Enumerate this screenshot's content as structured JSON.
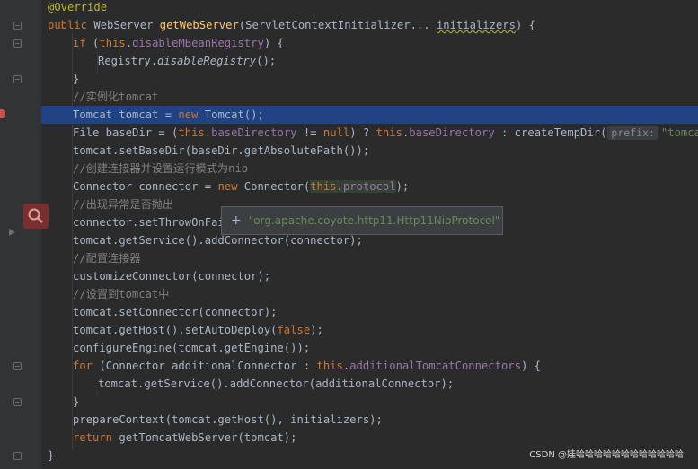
{
  "lines": [
    {
      "indent": 0,
      "tokens": [
        {
          "c": "ann",
          "t": "@Override"
        }
      ]
    },
    {
      "indent": 0,
      "tokens": [
        {
          "c": "kw",
          "t": "public "
        },
        {
          "c": "",
          "t": "WebServer "
        },
        {
          "c": "fn",
          "t": "getWebServer"
        },
        {
          "c": "",
          "t": "(ServletContextInitializer... "
        },
        {
          "c": "underline",
          "t": "initializers"
        },
        {
          "c": "",
          "t": ") {"
        }
      ]
    },
    {
      "indent": 1,
      "tokens": [
        {
          "c": "kw",
          "t": "if "
        },
        {
          "c": "",
          "t": "("
        },
        {
          "c": "kw",
          "t": "this"
        },
        {
          "c": "",
          "t": "."
        },
        {
          "c": "fld",
          "t": "disableMBeanRegistry"
        },
        {
          "c": "",
          "t": ") {"
        }
      ]
    },
    {
      "indent": 2,
      "tokens": [
        {
          "c": "",
          "t": "Registry."
        },
        {
          "c": "ital",
          "t": "disableRegistry"
        },
        {
          "c": "",
          "t": "();"
        }
      ]
    },
    {
      "indent": 1,
      "tokens": [
        {
          "c": "",
          "t": "}"
        }
      ]
    },
    {
      "indent": 1,
      "tokens": [
        {
          "c": "cmt",
          "t": "//实例化tomcat"
        }
      ]
    },
    {
      "indent": 1,
      "tokens": [
        {
          "c": "",
          "t": "Tomcat tomcat = "
        },
        {
          "c": "kw",
          "t": "new "
        },
        {
          "c": "",
          "t": "Tomcat();"
        }
      ]
    },
    {
      "indent": 1,
      "tokens": [
        {
          "c": "",
          "t": "File baseDir = ("
        },
        {
          "c": "kw",
          "t": "this"
        },
        {
          "c": "",
          "t": "."
        },
        {
          "c": "fld",
          "t": "baseDirectory"
        },
        {
          "c": "",
          "t": " != "
        },
        {
          "c": "kw",
          "t": "null"
        },
        {
          "c": "",
          "t": ") ? "
        },
        {
          "c": "kw",
          "t": "this"
        },
        {
          "c": "",
          "t": "."
        },
        {
          "c": "fld",
          "t": "baseDirectory"
        },
        {
          "c": "",
          "t": " : createTempDir("
        },
        {
          "c": "hint",
          "t": "prefix:"
        },
        {
          "c": "str",
          "t": "\"tomcat\""
        },
        {
          "c": "",
          "t": ");"
        }
      ]
    },
    {
      "indent": 1,
      "tokens": [
        {
          "c": "",
          "t": "tomcat.setBaseDir(baseDir.getAbsolutePath());"
        }
      ]
    },
    {
      "indent": 1,
      "tokens": [
        {
          "c": "cmt",
          "t": "//创建连接器并设置运行模式为nio"
        }
      ]
    },
    {
      "indent": 1,
      "tokens": [
        {
          "c": "",
          "t": "Connector connector = "
        },
        {
          "c": "kw",
          "t": "new "
        },
        {
          "c": "",
          "t": "Connector("
        },
        {
          "c": "kw thisprot",
          "t": "this"
        },
        {
          "c": "thisprot",
          "t": "."
        },
        {
          "c": "fld thisprot",
          "t": "protocol"
        },
        {
          "c": "",
          "t": ");"
        }
      ]
    },
    {
      "indent": 1,
      "tokens": [
        {
          "c": "cmt",
          "t": "//出现异常是否抛出"
        }
      ]
    },
    {
      "indent": 1,
      "tokens": [
        {
          "c": "",
          "t": "connector.setThrowOnFail"
        }
      ]
    },
    {
      "indent": 1,
      "tokens": [
        {
          "c": "",
          "t": "tomcat.getService().addConnector(connector);"
        }
      ]
    },
    {
      "indent": 1,
      "tokens": [
        {
          "c": "cmt",
          "t": "//配置连接器"
        }
      ]
    },
    {
      "indent": 1,
      "tokens": [
        {
          "c": "",
          "t": "customizeConnector(connector);"
        }
      ]
    },
    {
      "indent": 1,
      "tokens": [
        {
          "c": "cmt",
          "t": "//设置到tomcat中"
        }
      ]
    },
    {
      "indent": 1,
      "tokens": [
        {
          "c": "",
          "t": "tomcat.setConnector(connector);"
        }
      ]
    },
    {
      "indent": 1,
      "tokens": [
        {
          "c": "",
          "t": "tomcat.getHost().setAutoDeploy("
        },
        {
          "c": "kw",
          "t": "false"
        },
        {
          "c": "",
          "t": ");"
        }
      ]
    },
    {
      "indent": 1,
      "tokens": [
        {
          "c": "",
          "t": "configureEngine(tomcat.getEngine());"
        }
      ]
    },
    {
      "indent": 1,
      "tokens": [
        {
          "c": "kw",
          "t": "for "
        },
        {
          "c": "",
          "t": "(Connector additionalConnector : "
        },
        {
          "c": "kw",
          "t": "this"
        },
        {
          "c": "",
          "t": "."
        },
        {
          "c": "fld",
          "t": "additionalTomcatConnectors"
        },
        {
          "c": "",
          "t": ") {"
        }
      ]
    },
    {
      "indent": 2,
      "tokens": [
        {
          "c": "",
          "t": "tomcat.getService().addConnector(additionalConnector);"
        }
      ]
    },
    {
      "indent": 1,
      "tokens": [
        {
          "c": "",
          "t": "}"
        }
      ]
    },
    {
      "indent": 1,
      "tokens": [
        {
          "c": "",
          "t": "prepareContext(tomcat.getHost(), initializers);"
        }
      ]
    },
    {
      "indent": 1,
      "tokens": [
        {
          "c": "kw",
          "t": "return "
        },
        {
          "c": "",
          "t": "getTomcatWebServer(tomcat);"
        }
      ]
    },
    {
      "indent": 0,
      "tokens": [
        {
          "c": "",
          "t": "}"
        }
      ]
    }
  ],
  "current_line": 6,
  "tooltip": {
    "text": "\"org.apache.coyote.http11.Http11NioProtocol\""
  },
  "watermark": "CSDN @娃哈哈哈哈哈哈哈哈哈哈哈哈"
}
